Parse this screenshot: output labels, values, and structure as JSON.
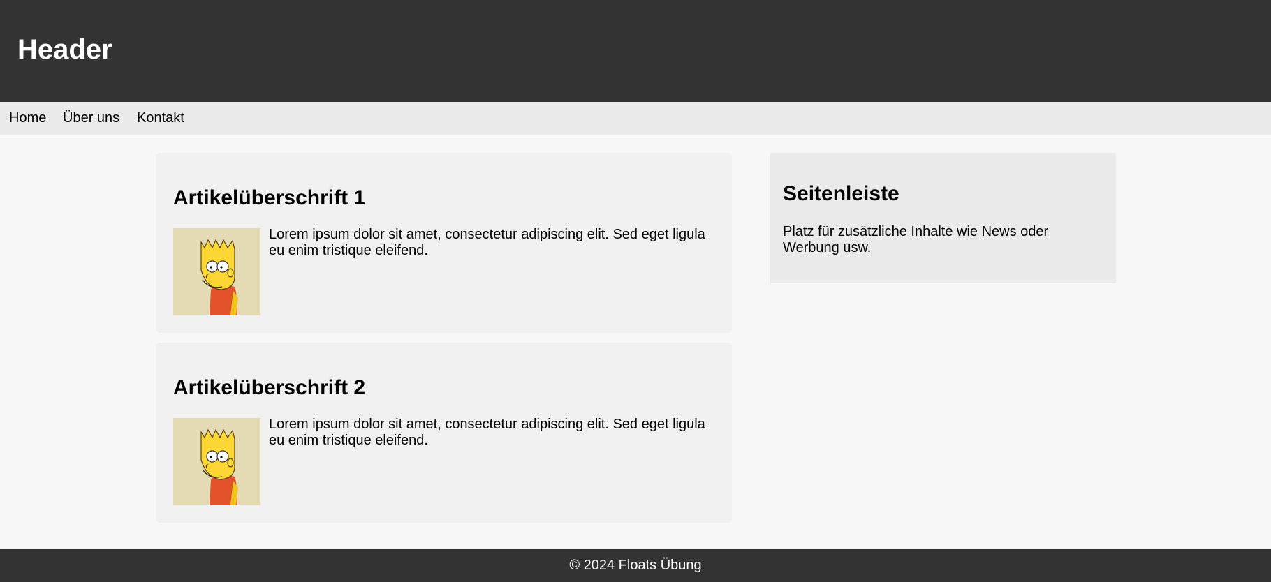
{
  "header": {
    "title": "Header"
  },
  "nav": {
    "items": [
      {
        "label": "Home"
      },
      {
        "label": "Über uns"
      },
      {
        "label": "Kontakt"
      }
    ]
  },
  "articles": [
    {
      "title": "Artikelüberschrift 1",
      "text": "Lorem ipsum dolor sit amet, consectetur adipiscing elit. Sed eget ligula eu enim tristique eleifend.",
      "image_icon": "bart-simpson-cartoon-icon"
    },
    {
      "title": "Artikelüberschrift 2",
      "text": "Lorem ipsum dolor sit amet, consectetur adipiscing elit. Sed eget ligula eu enim tristique eleifend.",
      "image_icon": "bart-simpson-cartoon-icon"
    }
  ],
  "sidebar": {
    "title": "Seitenleiste",
    "text": "Platz für zusätzliche Inhalte wie News oder Werbung usw."
  },
  "footer": {
    "text": "© 2024 Floats Übung"
  },
  "colors": {
    "header_bg": "#333333",
    "nav_bg": "#eaeaea",
    "page_bg": "#f7f7f7",
    "article_bg": "#f0f0f0",
    "sidebar_bg": "#eaeaea",
    "footer_bg": "#333333"
  }
}
